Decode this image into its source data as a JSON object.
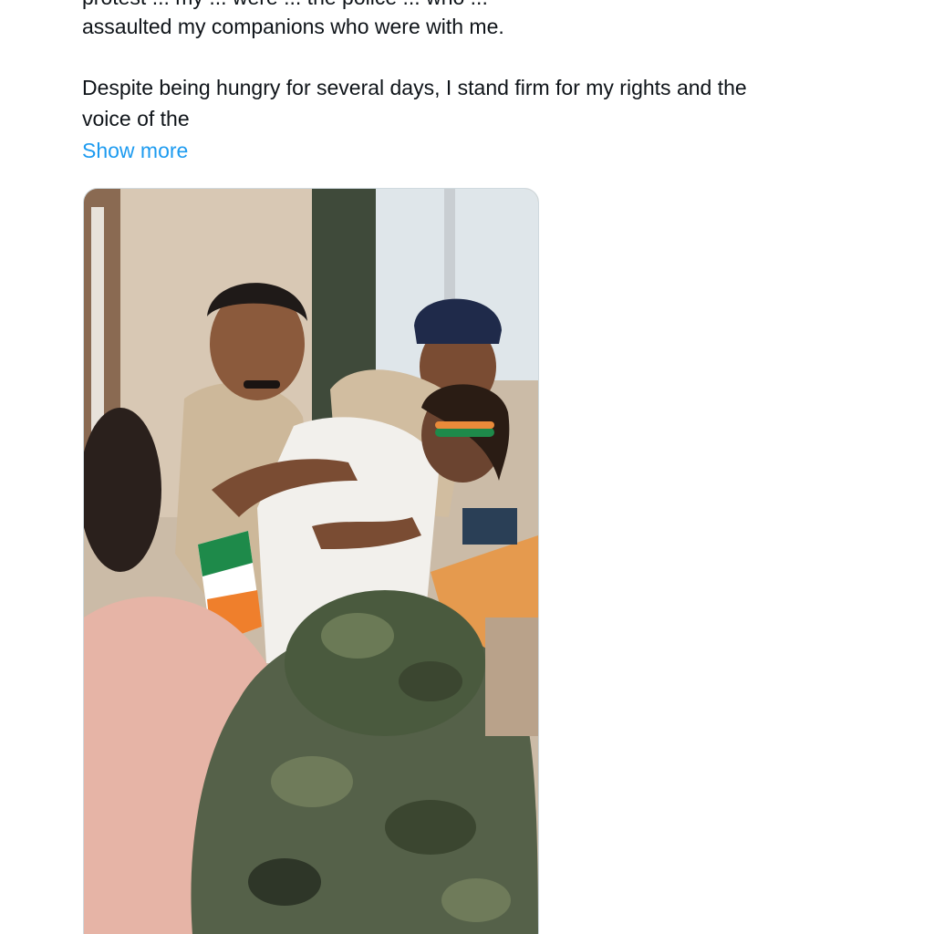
{
  "tweet": {
    "partial_line": "protest ... my ... were ... the police ... who ...",
    "paragraph1_line": "assaulted my companions who were with me.",
    "paragraph2_line1": "Despite being hungry for several days, I stand firm for my rights and the",
    "paragraph2_line2": "voice of the",
    "show_more_label": "Show more"
  },
  "media": {
    "type": "photo",
    "alt": "Police personnel restraining a man holding a tricolour flag"
  },
  "colors": {
    "text": "#0f1419",
    "link": "#1d9bf0",
    "border": "#cfd9de"
  }
}
